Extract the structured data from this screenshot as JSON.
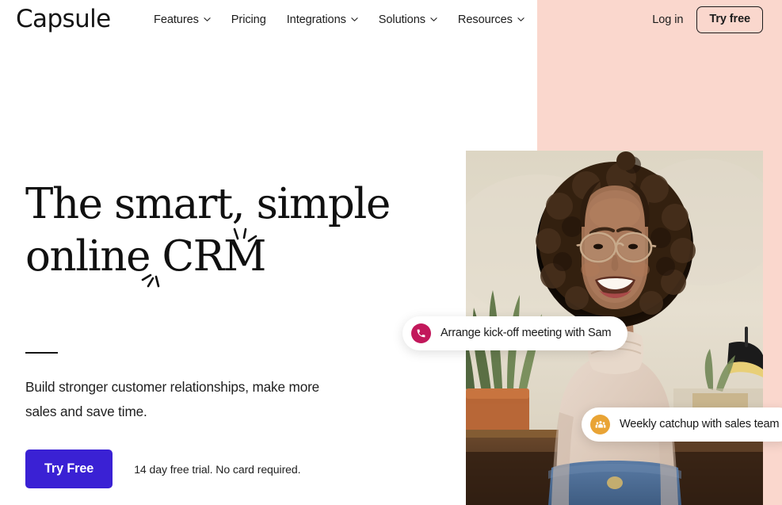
{
  "header": {
    "logo_text": "Capsule",
    "nav_items": [
      {
        "label": "Features",
        "has_dropdown": true,
        "icon": "chevron-down-icon"
      },
      {
        "label": "Pricing",
        "has_dropdown": false,
        "icon": ""
      },
      {
        "label": "Integrations",
        "has_dropdown": true,
        "icon": "chevron-down-icon"
      },
      {
        "label": "Solutions",
        "has_dropdown": true,
        "icon": "chevron-down-icon"
      },
      {
        "label": "Resources",
        "has_dropdown": true,
        "icon": "chevron-down-icon"
      }
    ],
    "login_label": "Log in",
    "try_free_label": "Try free"
  },
  "hero": {
    "heading": "The smart, simple\nonline CRM",
    "heading_line_1": "The smart, simple",
    "heading_line_2": "online CRM",
    "subheading": "Build stronger customer relationships, make more sales and save time.",
    "cta_label": "Try Free",
    "cta_note": "14 day free trial. No card required.",
    "decoration": "sparkle-marks"
  },
  "notifications": [
    {
      "id": "call",
      "label": "Arrange kick-off meeting with Sam",
      "icon": "phone-icon",
      "icon_color": "#c2185b"
    },
    {
      "id": "team",
      "label": "Weekly catchup with sales team",
      "icon": "people-group-icon",
      "icon_color": "#e9a435"
    }
  ],
  "photo": {
    "alt": "Smiling woman with curly hair and glasses wearing a cream turtleneck in an office"
  },
  "colors": {
    "accent_blue": "#3a21d4",
    "panel_pink": "#fad7cd",
    "text_dark": "#151515",
    "notif_pink": "#c2185b",
    "notif_orange": "#e9a435",
    "page_background": "#ffffff"
  }
}
